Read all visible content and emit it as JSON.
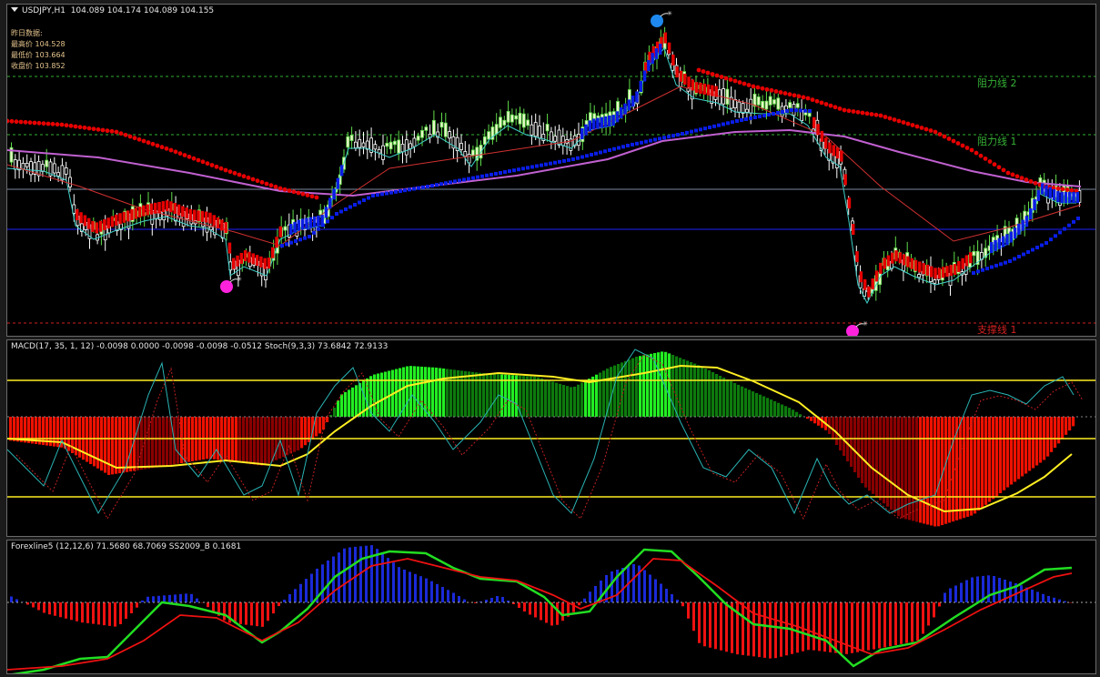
{
  "colors": {
    "bull": "#e8f5c8",
    "bear": "#ffffff",
    "up_dots": "#0a1de6",
    "down_dots": "#e60000",
    "ma_long": "#c060d0",
    "resist": "#35b035",
    "support": "#d02020",
    "macd_bright": "#22ee22",
    "macd_dark": "#0d7a0d",
    "macd_red": "#ee1100",
    "macd_darkred": "#8a0000",
    "signal": "#ffee22",
    "stoch": "#2ab3b3",
    "fx_green": "#22dd22",
    "fx_red": "#ee1111",
    "fx_blue": "#1a2ad8",
    "fx_redbar": "#ee1111"
  },
  "main": {
    "header": {
      "symbol": "USDJPY,H1",
      "ohlc": "104.089 104.174 104.089 104.155"
    },
    "prev_day": {
      "title": "昨日数据:",
      "high": "最高价 104.528",
      "low": "最低价 103.664",
      "close": "收盘价 103.852"
    },
    "levels": {
      "resist2": "阻力线 2",
      "resist1": "阻力线 1",
      "support1": "支撑线 1"
    },
    "markers": [
      {
        "icon": "bomb-icon",
        "color": "#1e88ee"
      },
      {
        "icon": "bomb-icon",
        "color": "#ff22dd"
      },
      {
        "icon": "bomb-icon",
        "color": "#ff22dd"
      }
    ],
    "candles_note": ""
  },
  "macd": {
    "header": "MACD(17, 35, 1, 12) -0.0098 0.0000 -0.0098 -0.0098 -0.0512  Stoch(9,3,3) 73.6842 72.9133"
  },
  "fx": {
    "header": "Forexline5 (12,12,6) 71.5680 68.7069  SS2009_B 0.1681"
  }
}
